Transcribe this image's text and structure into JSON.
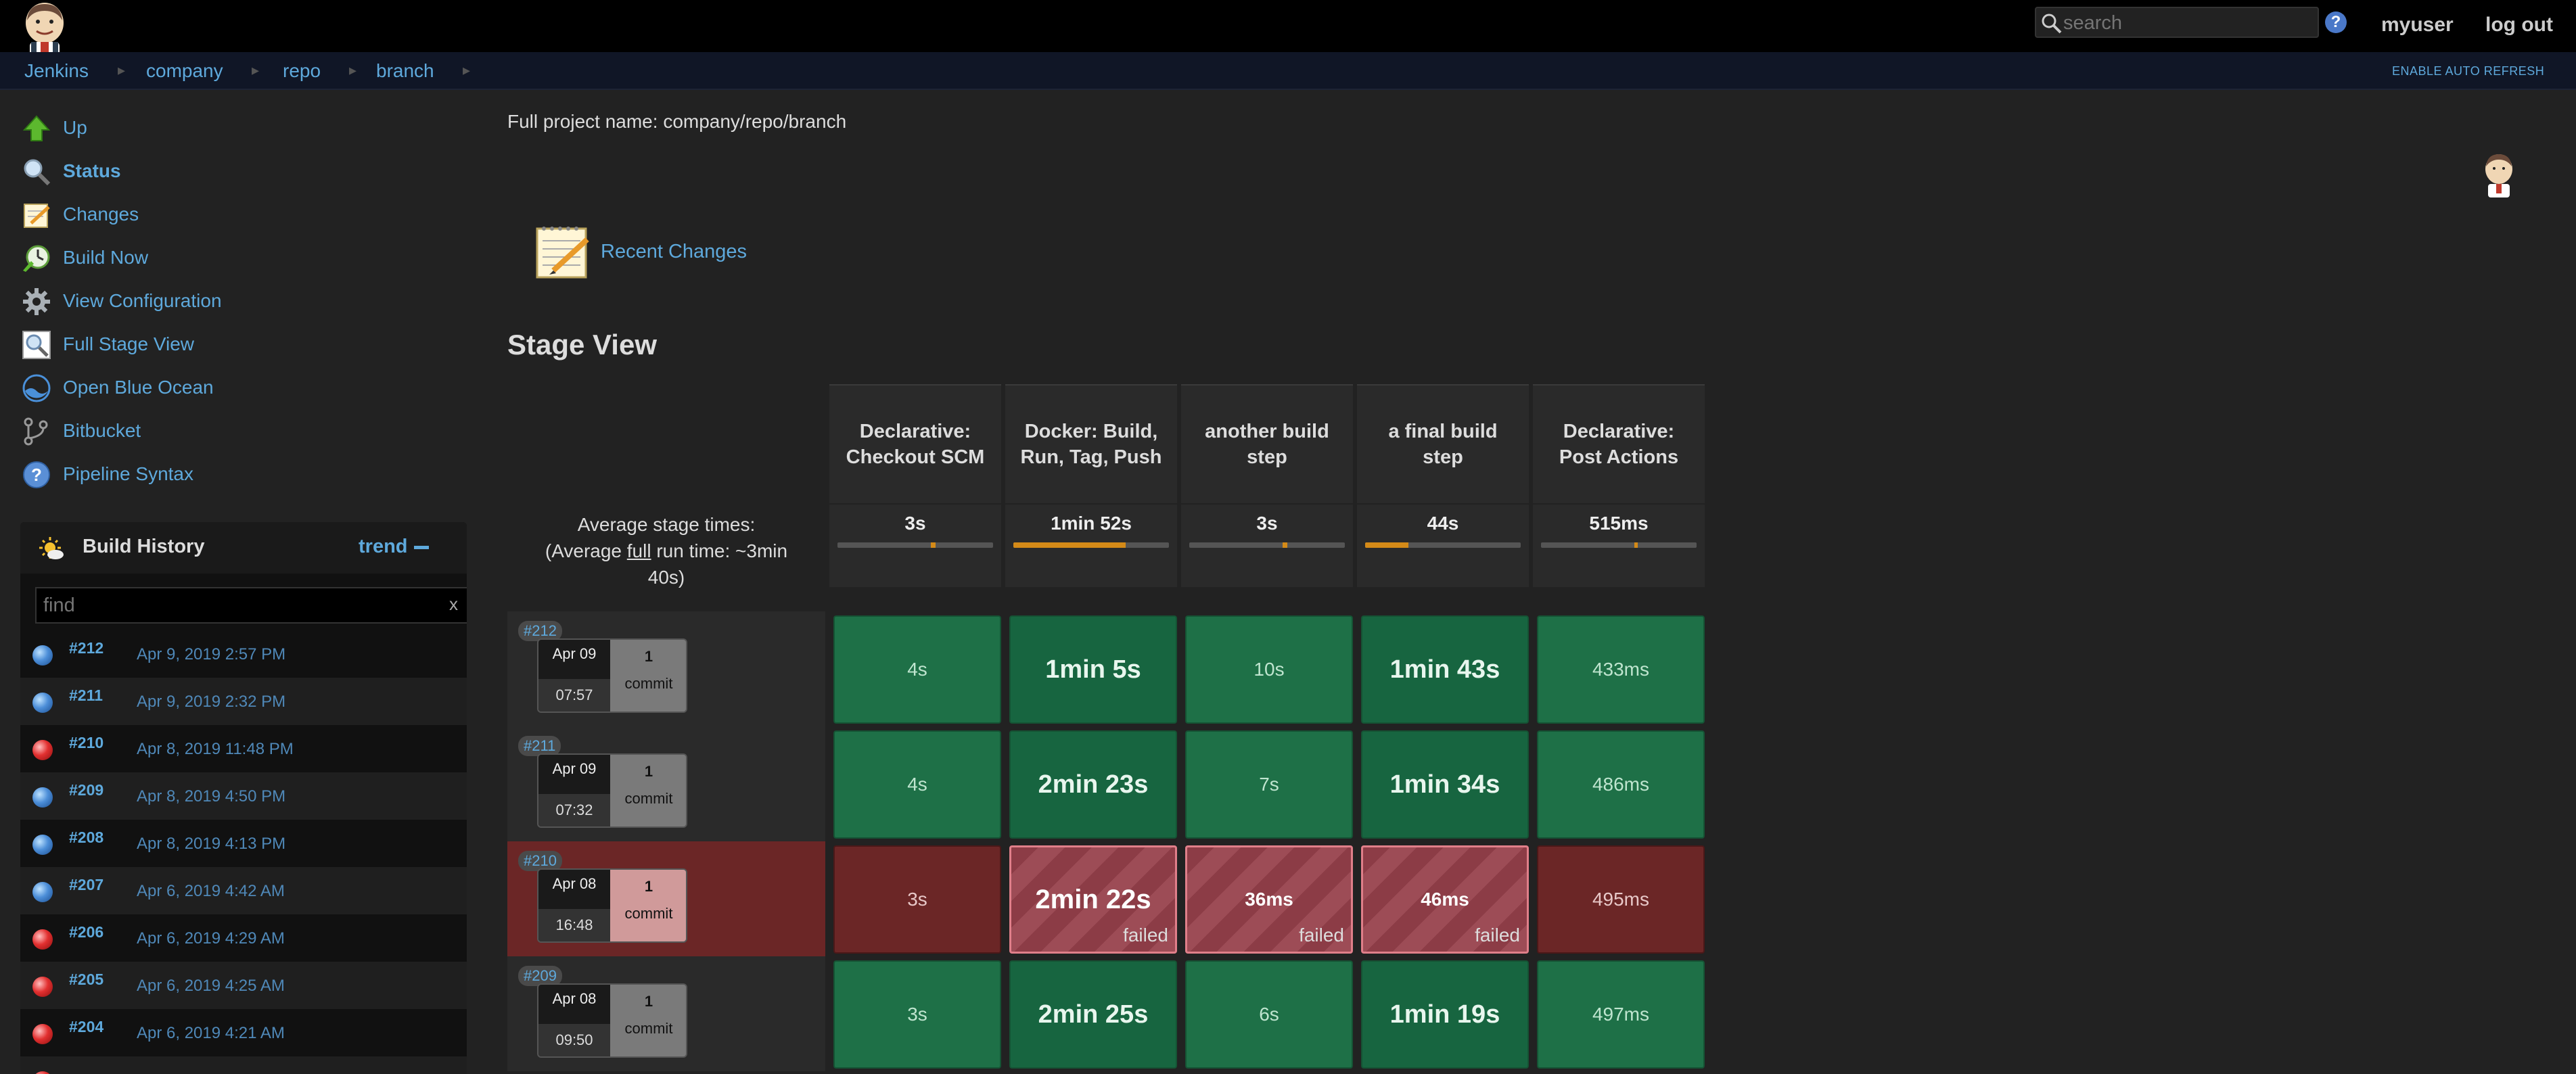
{
  "header": {
    "search_placeholder": "search",
    "help": "?",
    "user": "myuser",
    "logout": "log out"
  },
  "breadcrumb": {
    "items": [
      "Jenkins",
      "company",
      "repo",
      "branch"
    ],
    "auto_refresh": "ENABLE AUTO REFRESH"
  },
  "sidebar": {
    "tasks": [
      {
        "label": "Up",
        "icon": "up-arrow-icon"
      },
      {
        "label": "Status",
        "icon": "magnifier-icon"
      },
      {
        "label": "Changes",
        "icon": "notepad-icon"
      },
      {
        "label": "Build Now",
        "icon": "build-clock-icon"
      },
      {
        "label": "View Configuration",
        "icon": "gear-icon"
      },
      {
        "label": "Full Stage View",
        "icon": "magnifier-doc-icon"
      },
      {
        "label": "Open Blue Ocean",
        "icon": "blue-ocean-icon"
      },
      {
        "label": "Bitbucket",
        "icon": "branch-icon"
      },
      {
        "label": "Pipeline Syntax",
        "icon": "help-icon"
      }
    ]
  },
  "build_history": {
    "title": "Build History",
    "trend": "trend",
    "filter_placeholder": "find",
    "clear": "x",
    "builds": [
      {
        "num": "#212",
        "date": "Apr 9, 2019 2:57 PM",
        "status": "blue"
      },
      {
        "num": "#211",
        "date": "Apr 9, 2019 2:32 PM",
        "status": "blue"
      },
      {
        "num": "#210",
        "date": "Apr 8, 2019 11:48 PM",
        "status": "red"
      },
      {
        "num": "#209",
        "date": "Apr 8, 2019 4:50 PM",
        "status": "blue"
      },
      {
        "num": "#208",
        "date": "Apr 8, 2019 4:13 PM",
        "status": "blue"
      },
      {
        "num": "#207",
        "date": "Apr 6, 2019 4:42 AM",
        "status": "blue"
      },
      {
        "num": "#206",
        "date": "Apr 6, 2019 4:29 AM",
        "status": "red"
      },
      {
        "num": "#205",
        "date": "Apr 6, 2019 4:25 AM",
        "status": "red"
      },
      {
        "num": "#204",
        "date": "Apr 6, 2019 4:21 AM",
        "status": "red"
      }
    ]
  },
  "main": {
    "full_name": "Full project name: company/repo/branch",
    "recent_changes": "Recent Changes",
    "stage_view_title": "Stage View",
    "avg_label_1": "Average stage times:",
    "avg_label_2a": "(Average ",
    "avg_label_2b": "full",
    "avg_label_2c": " run time: ~3min",
    "avg_label_3": "40s)"
  },
  "stages": [
    {
      "name": "Declarative: Checkout SCM",
      "avg": "3s",
      "avg_fraction": 0.03
    },
    {
      "name": "Docker: Build, Run, Tag, Push",
      "avg": "1min 52s",
      "avg_fraction": 0.72
    },
    {
      "name": "another build step",
      "avg": "3s",
      "avg_fraction": 0.03
    },
    {
      "name": "a final build step",
      "avg": "44s",
      "avg_fraction": 0.28
    },
    {
      "name": "Declarative: Post Actions",
      "avg": "515ms",
      "avg_fraction": 0.01
    }
  ],
  "runs": [
    {
      "id": "#212",
      "date": "Apr 09",
      "time": "07:57",
      "commits": "1",
      "commit_label": "commit",
      "failed": false,
      "cells": [
        {
          "value": "4s",
          "state": "ok",
          "big": false
        },
        {
          "value": "1min 5s",
          "state": "ok",
          "big": true
        },
        {
          "value": "10s",
          "state": "ok",
          "big": false
        },
        {
          "value": "1min 43s",
          "state": "ok",
          "big": true
        },
        {
          "value": "433ms",
          "state": "ok",
          "big": false
        }
      ]
    },
    {
      "id": "#211",
      "date": "Apr 09",
      "time": "07:32",
      "commits": "1",
      "commit_label": "commit",
      "failed": false,
      "cells": [
        {
          "value": "4s",
          "state": "ok",
          "big": false
        },
        {
          "value": "2min 23s",
          "state": "ok",
          "big": true
        },
        {
          "value": "7s",
          "state": "ok",
          "big": false
        },
        {
          "value": "1min 34s",
          "state": "ok",
          "big": true
        },
        {
          "value": "486ms",
          "state": "ok",
          "big": false
        }
      ]
    },
    {
      "id": "#210",
      "date": "Apr 08",
      "time": "16:48",
      "commits": "1",
      "commit_label": "commit",
      "failed": true,
      "cells": [
        {
          "value": "3s",
          "state": "fail-plain",
          "big": false
        },
        {
          "value": "2min 22s",
          "state": "fail",
          "big": true,
          "tag": "failed"
        },
        {
          "value": "36ms",
          "state": "fail",
          "big": false,
          "tag": "failed"
        },
        {
          "value": "46ms",
          "state": "fail",
          "big": false,
          "tag": "failed"
        },
        {
          "value": "495ms",
          "state": "fail-plain",
          "big": false
        }
      ]
    },
    {
      "id": "#209",
      "date": "Apr 08",
      "time": "09:50",
      "commits": "1",
      "commit_label": "commit",
      "failed": false,
      "cells": [
        {
          "value": "3s",
          "state": "ok",
          "big": false
        },
        {
          "value": "2min 25s",
          "state": "ok",
          "big": true
        },
        {
          "value": "6s",
          "state": "ok",
          "big": false
        },
        {
          "value": "1min 19s",
          "state": "ok",
          "big": true
        },
        {
          "value": "497ms",
          "state": "ok",
          "big": false
        }
      ]
    }
  ]
}
